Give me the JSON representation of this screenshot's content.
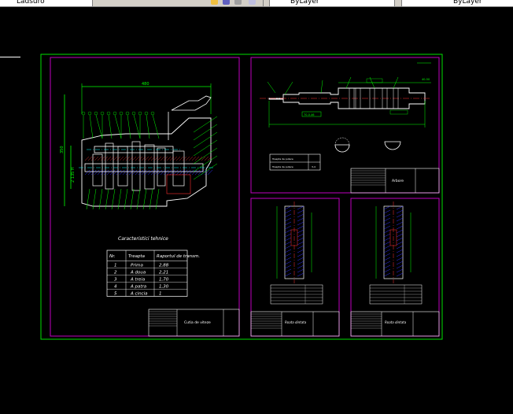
{
  "toolbar": {
    "left_label": "Ladsuro",
    "layer_label": "ByLayer",
    "right_label": "ByLayer"
  },
  "drawing": {
    "main_sheet": {
      "gearbox_title": "Cutia de viteze",
      "table_title": "Caracteristici tehnice",
      "table_headers": [
        "Nr.",
        "Treapta",
        "Raportul de transm."
      ],
      "table_rows": [
        [
          "1",
          "Prima",
          "2,88"
        ],
        [
          "2",
          "A doua",
          "2,21"
        ],
        [
          "3",
          "A treia",
          "1,70"
        ],
        [
          "4",
          "A patra",
          "1,30"
        ],
        [
          "5",
          "A cincia",
          "1"
        ]
      ],
      "dim_top": "480",
      "dim_left": "350",
      "dim_left2": "2 135 H"
    },
    "shaft_sheet": {
      "title": "Arbore",
      "dim_right": "40-50",
      "dim_label": "70-0.46",
      "table_rows": [
        "Treapta de putere",
        "Treapta de putere"
      ],
      "table_values": [
        "",
        "3-4"
      ]
    },
    "gear_sheet_1": {
      "title": "Roata dintata"
    },
    "gear_sheet_2": {
      "title": "Roata dintata"
    },
    "colors": {
      "sheet_border": "#00e000",
      "frame": "#c000c0",
      "lines": "#ffffff",
      "dims": "#00ff00",
      "blue": "#3030ff",
      "cyan": "#00ffff",
      "red": "#ff3030"
    }
  }
}
